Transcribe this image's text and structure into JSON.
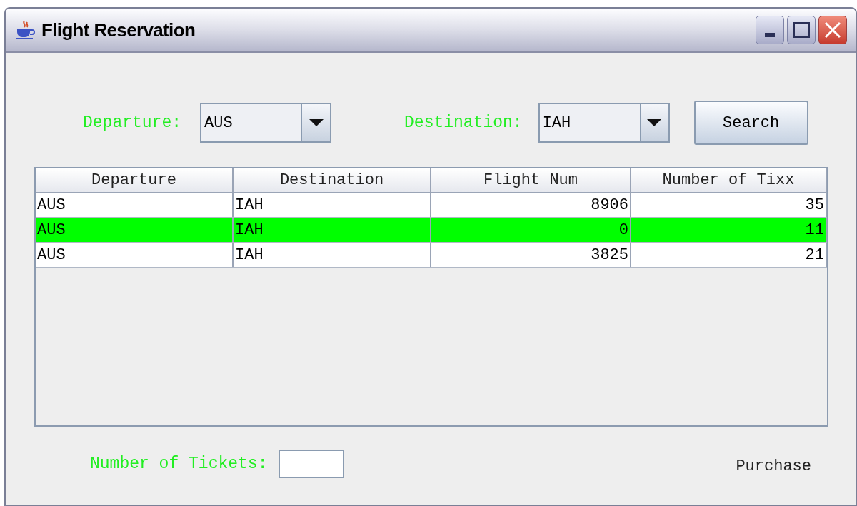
{
  "window": {
    "title": "Flight Reservation"
  },
  "search_bar": {
    "departure_label": "Departure:",
    "departure_value": "AUS",
    "destination_label": "Destination:",
    "destination_value": "IAH",
    "search_button": "Search"
  },
  "table": {
    "columns": [
      "Departure",
      "Destination",
      "Flight Num",
      "Number of Tixx"
    ],
    "rows": [
      {
        "cells": [
          "AUS",
          "IAH",
          "8906",
          "35"
        ],
        "selected": false
      },
      {
        "cells": [
          "AUS",
          "IAH",
          "0",
          "11"
        ],
        "selected": true
      },
      {
        "cells": [
          "AUS",
          "IAH",
          "3825",
          "21"
        ],
        "selected": false
      }
    ]
  },
  "footer": {
    "tickets_label": "Number of Tickets:",
    "purchase_button": "Purchase"
  }
}
